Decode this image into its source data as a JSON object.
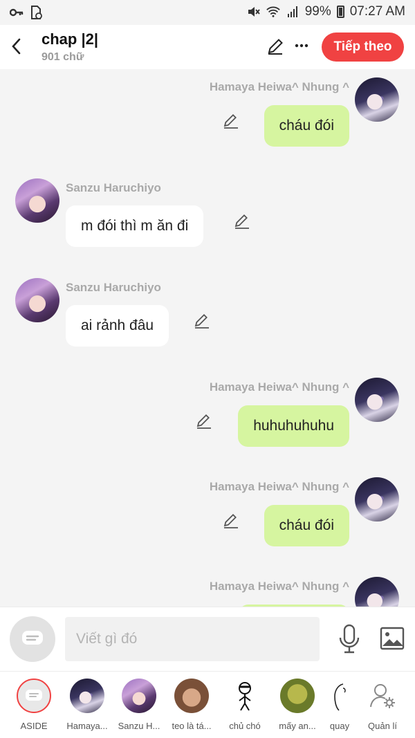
{
  "status_bar": {
    "battery": "99%",
    "time": "07:27 AM"
  },
  "header": {
    "title": "chap |2|",
    "subtitle": "901 chữ",
    "next_button": "Tiếp theo"
  },
  "messages": [
    {
      "side": "right",
      "name": "Hamaya Heiwa^ Nhung ^",
      "text": "cháu đói"
    },
    {
      "side": "left",
      "name": "Sanzu Haruchiyo",
      "text": "m đói thì m ăn đi"
    },
    {
      "side": "left",
      "name": "Sanzu Haruchiyo",
      "text": "ai rảnh đâu"
    },
    {
      "side": "right",
      "name": "Hamaya Heiwa^ Nhung ^",
      "text": "huhuhuhuhu"
    },
    {
      "side": "right",
      "name": "Hamaya Heiwa^ Nhung ^",
      "text": "cháu đói"
    },
    {
      "side": "right",
      "name": "Hamaya Heiwa^ Nhung ^",
      "text": ""
    }
  ],
  "composer": {
    "placeholder": "Viết gì đó"
  },
  "characters": [
    {
      "label": "ASIDE",
      "icon": "aside-chat-icon"
    },
    {
      "label": "Hamaya...",
      "icon": "hamaya-avatar"
    },
    {
      "label": "Sanzu H...",
      "icon": "sanzu-avatar"
    },
    {
      "label": "teo là tá...",
      "icon": "teo-avatar"
    },
    {
      "label": "chủ chó",
      "icon": "stick-figure-avatar"
    },
    {
      "label": "mấy an...",
      "icon": "shrek-avatar"
    },
    {
      "label": "quay",
      "icon": "sketch-avatar"
    },
    {
      "label": "Quản lí",
      "icon": "manage-user-icon"
    }
  ],
  "colors": {
    "accent": "#f04242",
    "my_bubble": "#d6f5a0",
    "their_bubble": "#ffffff",
    "background": "#f4f4f4"
  }
}
